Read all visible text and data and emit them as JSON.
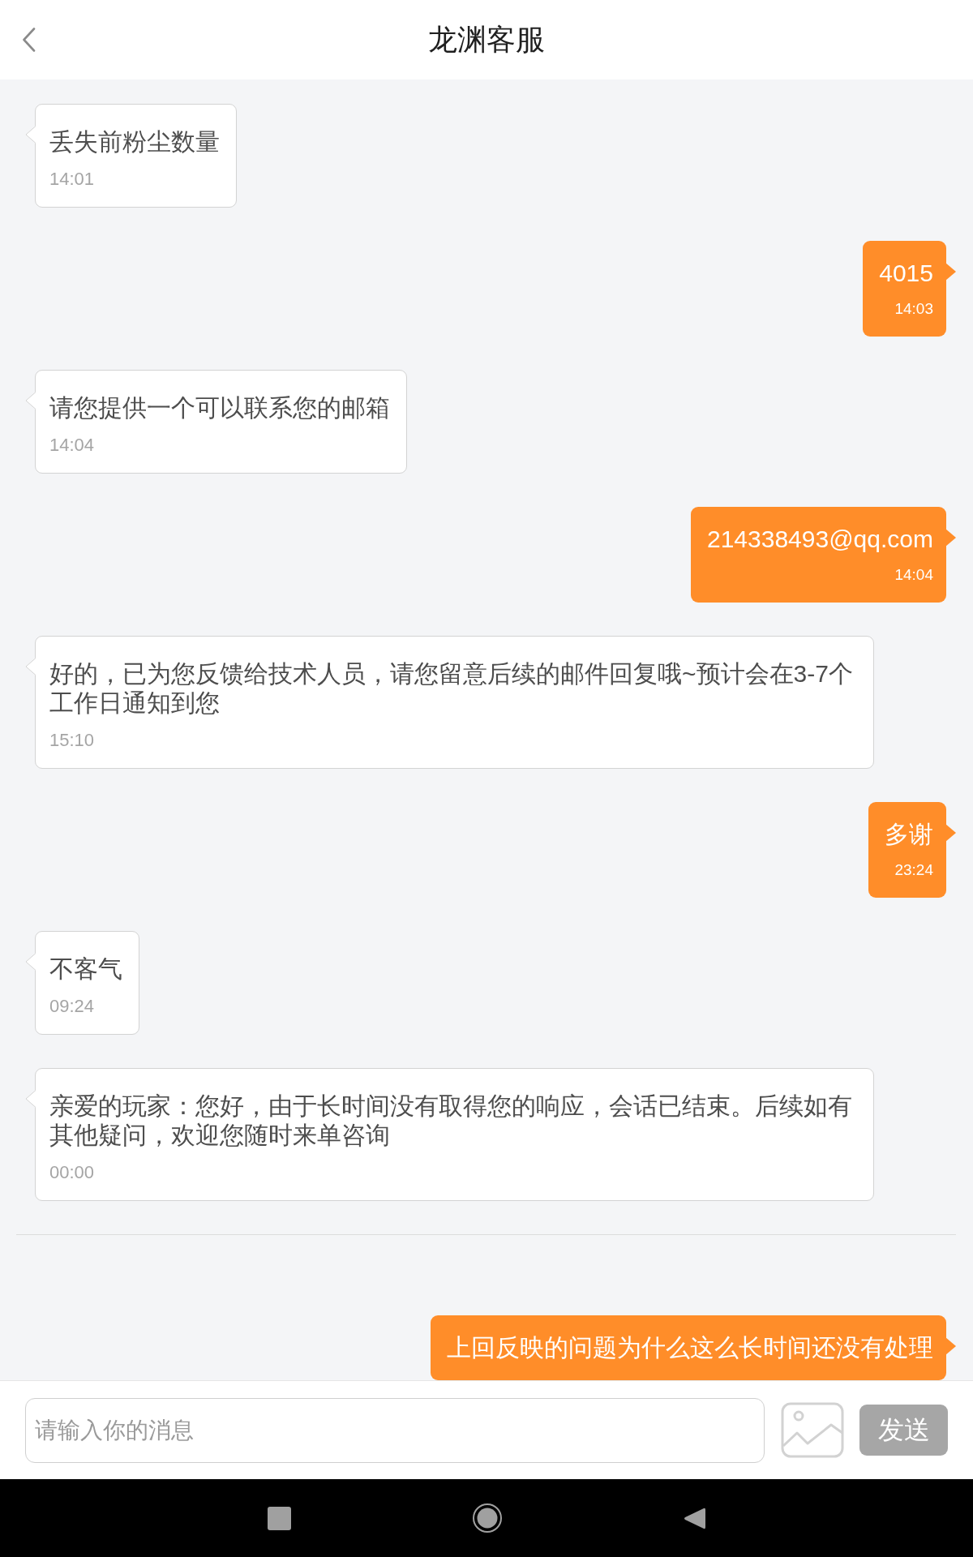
{
  "header": {
    "title": "龙渊客服"
  },
  "messages": [
    {
      "kind": "received",
      "text": "丢失前粉尘数量",
      "time": "14:01"
    },
    {
      "kind": "sent",
      "text": "4015",
      "time": "14:03"
    },
    {
      "kind": "received",
      "text": "请您提供一个可以联系您的邮箱",
      "time": "14:04"
    },
    {
      "kind": "sent",
      "text": "214338493@qq.com",
      "time": "14:04"
    },
    {
      "kind": "received",
      "text": "好的，已为您反馈给技术人员，请您留意后续的邮件回复哦~预计会在3-7个工作日通知到您",
      "time": "15:10"
    },
    {
      "kind": "sent",
      "text": "多谢",
      "time": "23:24"
    },
    {
      "kind": "received",
      "text": "不客气",
      "time": "09:24"
    },
    {
      "kind": "received",
      "text": "亲爱的玩家：您好，由于长时间没有取得您的响应，会话已结束。后续如有其他疑问，欢迎您随时来单咨询",
      "time": "00:00"
    },
    {
      "kind": "divider"
    },
    {
      "kind": "sent",
      "text": "上回反映的问题为什么这么长时间还没有处理"
    }
  ],
  "composer": {
    "placeholder": "请输入你的消息",
    "send_button": {
      "label": "发送",
      "disabled": true
    }
  }
}
